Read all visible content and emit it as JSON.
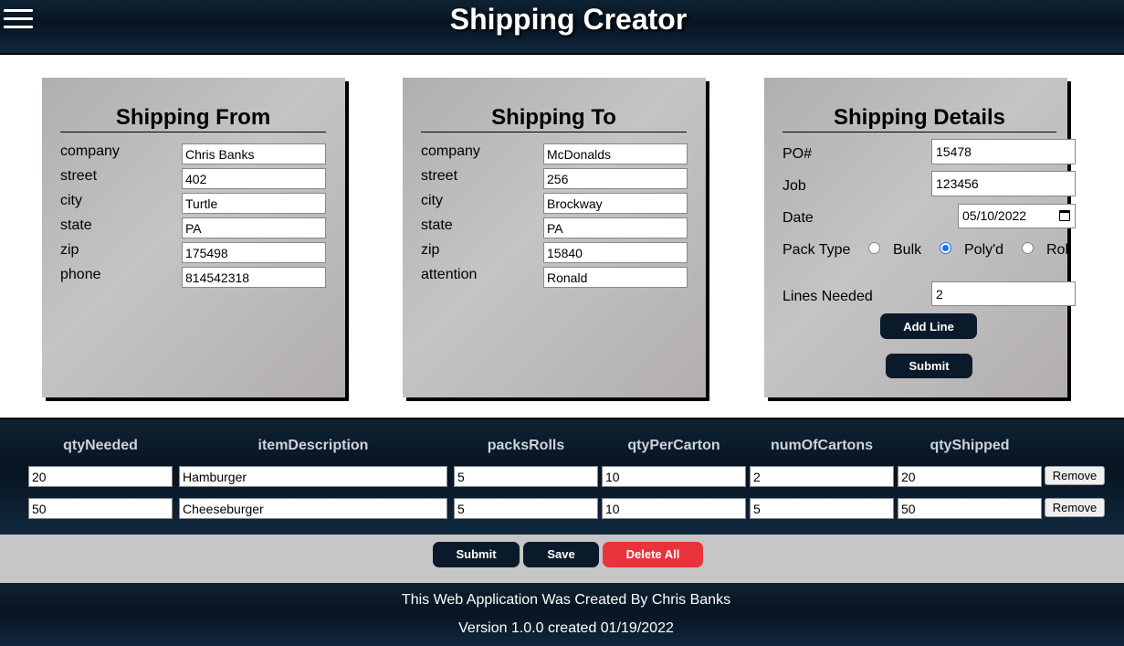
{
  "header": {
    "title": "Shipping Creator"
  },
  "shipping_from": {
    "title": "Shipping From",
    "fields": [
      {
        "label": "company",
        "value": "Chris Banks"
      },
      {
        "label": "street",
        "value": "402"
      },
      {
        "label": "city",
        "value": "Turtle"
      },
      {
        "label": "state",
        "value": "PA"
      },
      {
        "label": "zip",
        "value": "175498"
      },
      {
        "label": "phone",
        "value": "814542318"
      }
    ]
  },
  "shipping_to": {
    "title": "Shipping To",
    "fields": [
      {
        "label": "company",
        "value": "McDonalds"
      },
      {
        "label": "street",
        "value": "256"
      },
      {
        "label": "city",
        "value": "Brockway"
      },
      {
        "label": "state",
        "value": "PA"
      },
      {
        "label": "zip",
        "value": "15840"
      },
      {
        "label": "attention",
        "value": "Ronald"
      }
    ]
  },
  "shipping_details": {
    "title": "Shipping Details",
    "po_label": "PO#",
    "po_value": "15478",
    "job_label": "Job",
    "job_value": "123456",
    "date_label": "Date",
    "date_value": "05/10/2022",
    "pack_type_label": "Pack Type",
    "pack_options": [
      "Bulk",
      "Poly'd",
      "Roll"
    ],
    "pack_selected": "Poly'd",
    "lines_label": "Lines Needed",
    "lines_value": "2",
    "add_line_label": "Add Line",
    "submit_label": "Submit"
  },
  "lines": {
    "headers": [
      "qtyNeeded",
      "itemDescription",
      "packsRolls",
      "qtyPerCarton",
      "numOfCartons",
      "qtyShipped"
    ],
    "remove_label": "Remove",
    "rows": [
      {
        "qtyNeeded": "20",
        "itemDescription": "Hamburger",
        "packsRolls": "5",
        "qtyPerCarton": "10",
        "numOfCartons": "2",
        "qtyShipped": "20"
      },
      {
        "qtyNeeded": "50",
        "itemDescription": "Cheeseburger",
        "packsRolls": "5",
        "qtyPerCarton": "10",
        "numOfCartons": "5",
        "qtyShipped": "50"
      }
    ]
  },
  "actions": {
    "submit_label": "Submit",
    "save_label": "Save",
    "delete_all_label": "Delete All"
  },
  "footer": {
    "credit": "This Web Application Was Created By Chris Banks",
    "version": "Version 1.0.0 created 01/19/2022"
  },
  "colors": {
    "dark_navy": "#0b1a2a",
    "delete_red": "#e8333a",
    "card_gray": "#bdbbbb",
    "action_bar_gray": "#c6c6c6"
  }
}
